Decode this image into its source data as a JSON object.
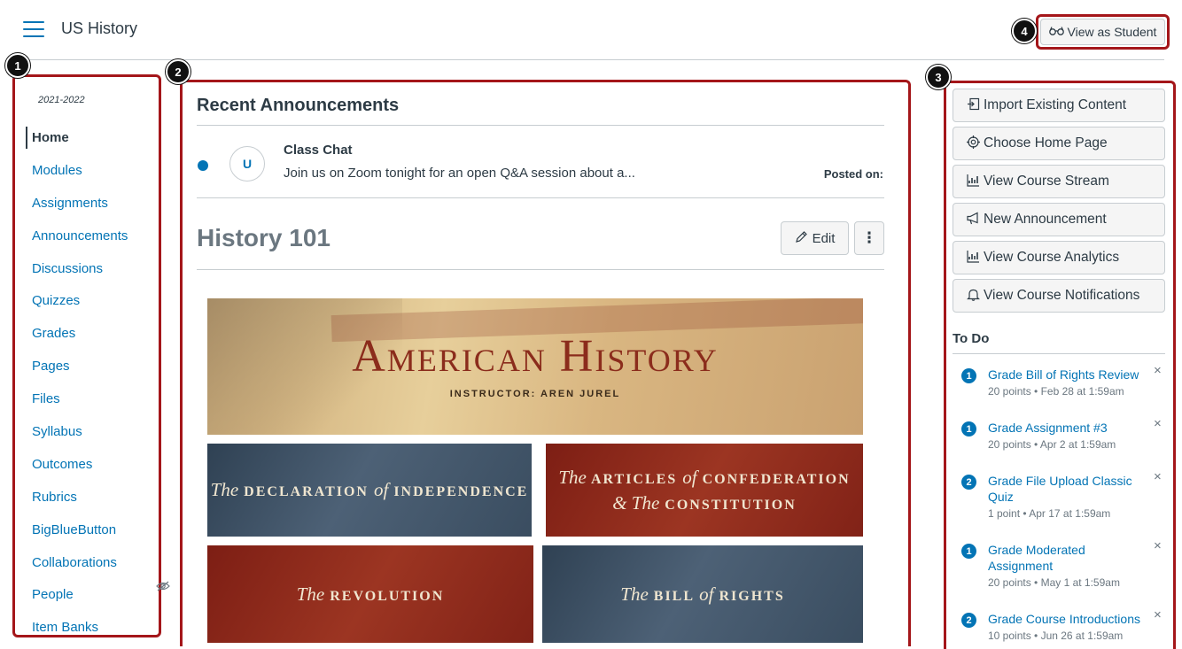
{
  "header": {
    "course_title": "US History",
    "view_as_student_label": "View as Student"
  },
  "callouts": [
    "1",
    "2",
    "3",
    "4"
  ],
  "sidebar": {
    "term": "2021-2022",
    "items": [
      {
        "label": "Home",
        "active": true
      },
      {
        "label": "Modules"
      },
      {
        "label": "Assignments"
      },
      {
        "label": "Announcements"
      },
      {
        "label": "Discussions"
      },
      {
        "label": "Quizzes"
      },
      {
        "label": "Grades"
      },
      {
        "label": "Pages"
      },
      {
        "label": "Files"
      },
      {
        "label": "Syllabus"
      },
      {
        "label": "Outcomes"
      },
      {
        "label": "Rubrics"
      },
      {
        "label": "BigBlueButton"
      },
      {
        "label": "Collaborations"
      },
      {
        "label": "People",
        "hidden_icon": "eye-off-icon"
      },
      {
        "label": "Item Banks"
      }
    ]
  },
  "main": {
    "announcements_heading": "Recent Announcements",
    "announcement": {
      "avatar_initial": "U",
      "title": "Class Chat",
      "body": "Join us on Zoom tonight for an open Q&A session about a...",
      "posted_label": "Posted on:"
    },
    "page_title": "History 101",
    "edit_label": "Edit",
    "banner": {
      "title": "American History",
      "subtitle": "INSTRUCTOR: AREN JUREL"
    },
    "tiles": [
      {
        "prefix": "The",
        "text": "DECLARATION",
        "mid": "of",
        "text2": "INDEPENDENCE"
      },
      {
        "prefix": "The",
        "text": "ARTICLES",
        "mid": "of",
        "text2": "CONFEDERATION",
        "line2_prefix": "& The",
        "line2": "CONSTITUTION"
      },
      {
        "prefix": "The",
        "text": "REVOLUTION"
      },
      {
        "prefix": "The",
        "text": "BILL",
        "mid": "of",
        "text2": "RIGHTS"
      }
    ]
  },
  "right": {
    "buttons": [
      {
        "label": "Import Existing Content",
        "icon": "import-icon"
      },
      {
        "label": "Choose Home Page",
        "icon": "target-icon"
      },
      {
        "label": "View Course Stream",
        "icon": "stream-chart-icon"
      },
      {
        "label": "New Announcement",
        "icon": "megaphone-icon"
      },
      {
        "label": "View Course Analytics",
        "icon": "analytics-chart-icon"
      },
      {
        "label": "View Course Notifications",
        "icon": "bell-icon"
      }
    ],
    "todo_heading": "To Do",
    "todos": [
      {
        "badge": "1",
        "title": "Grade Bill of Rights Review",
        "meta": "20 points • Feb 28 at 1:59am"
      },
      {
        "badge": "1",
        "title": "Grade Assignment #3",
        "meta": "20 points • Apr 2 at 1:59am"
      },
      {
        "badge": "2",
        "title": "Grade File Upload Classic Quiz",
        "meta": "1 point • Apr 17 at 1:59am"
      },
      {
        "badge": "1",
        "title": "Grade Moderated Assignment",
        "meta": "20 points • May 1 at 1:59am"
      },
      {
        "badge": "2",
        "title": "Grade Course Introductions",
        "meta": "10 points • Jun 26 at 1:59am"
      }
    ]
  },
  "colors": {
    "link": "#0374b5",
    "text": "#2d3b45",
    "highlight_border": "#a4161a",
    "border": "#c7cdd1"
  }
}
